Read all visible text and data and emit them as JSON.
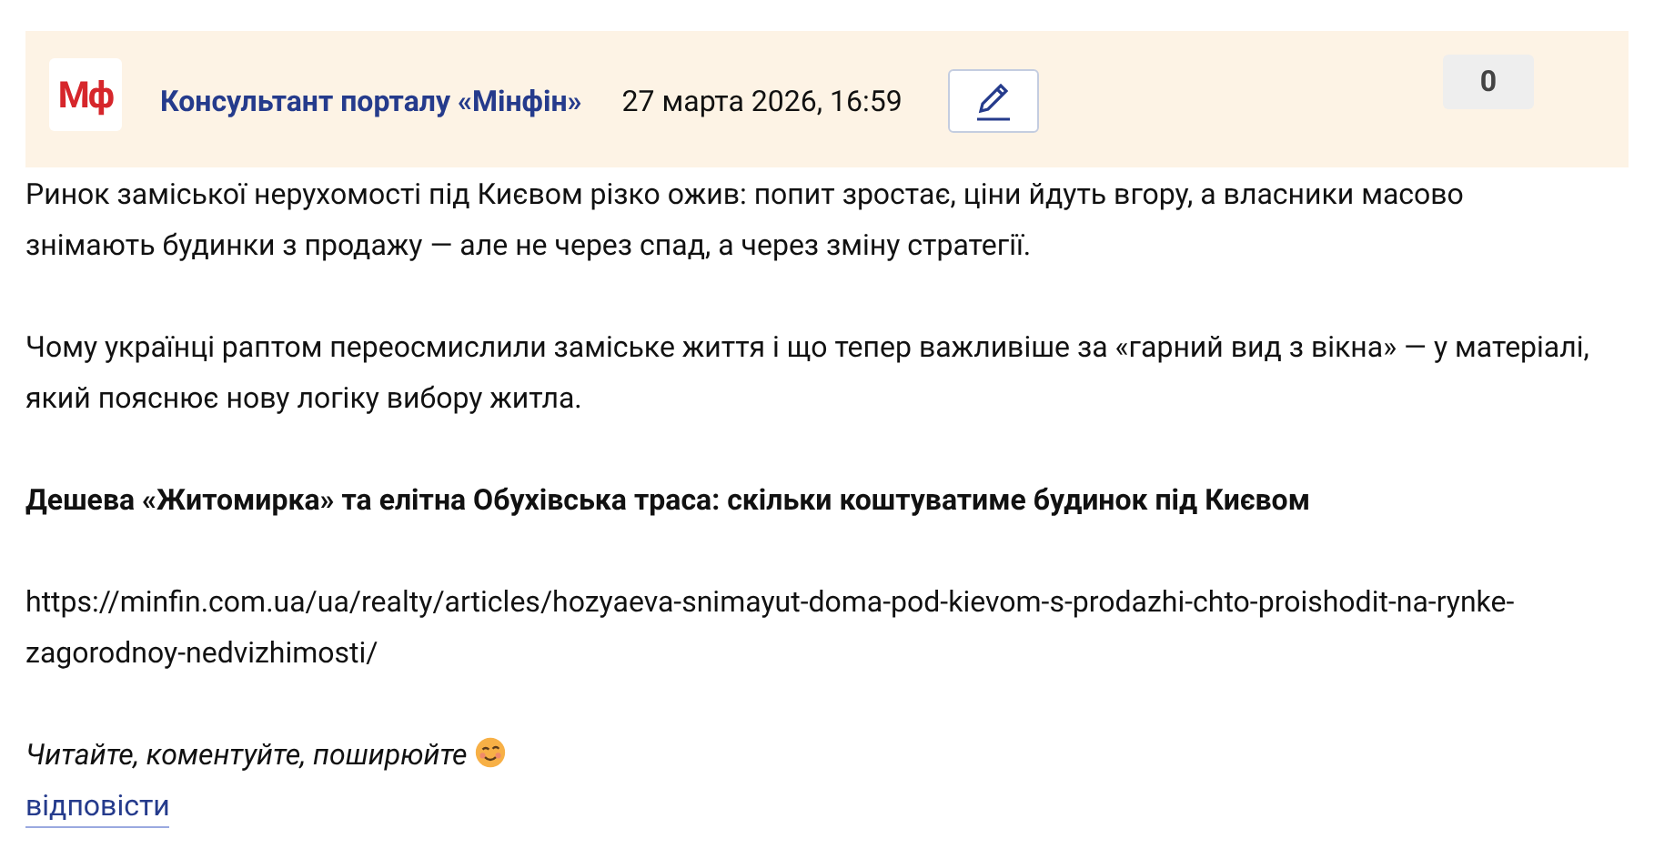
{
  "header": {
    "logo": "Мф",
    "author": "Консультант порталу «Мінфін»",
    "date": "27 марта 2026, 16:59",
    "count": "0"
  },
  "paragraphs": [
    {
      "kind": "text",
      "text": "Ринок заміської нерухомості під Києвом різко ожив: попит зростає, ціни йдуть вгору, а власники масово знімають будинки з продажу — але не через спад, а через зміну стратегії."
    },
    {
      "kind": "text",
      "text": "Чому українці раптом переосмислили заміське життя і що тепер важливіше за «гарний вид з вікна» — у матеріалі, який пояснює нову логіку вибору житла."
    },
    {
      "kind": "bold",
      "text": "Дешева «Житомирка» та елітна Обухівська траса: скільки коштуватиме будинок під Києвом"
    },
    {
      "kind": "url",
      "text": "https://minfin.com.ua/ua/realty/articles/hozyaeva-snimayut-doma-pod-kievom-s-prodazhi-chto-proishodit-na-rynke-zagorodnoy-nedvizhimosti/"
    }
  ],
  "closing": "Читайте, коментуйте, поширюйте",
  "reply_link": "відповісти"
}
